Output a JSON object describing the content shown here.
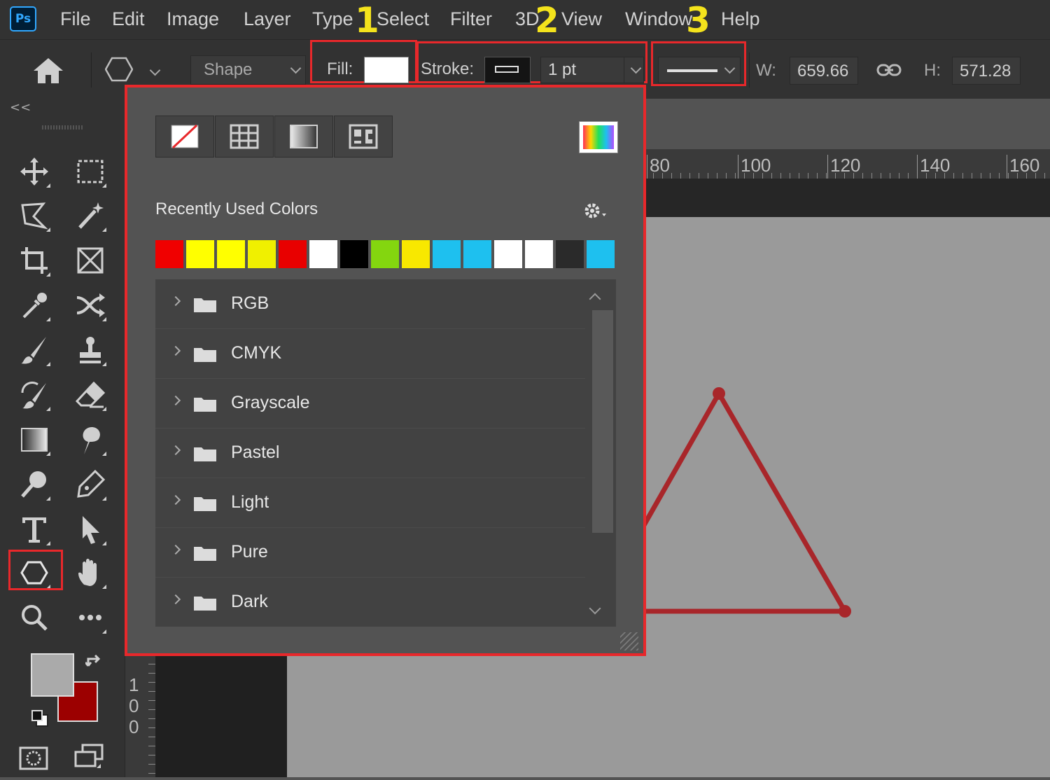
{
  "app": {
    "logo": "Ps"
  },
  "menu": [
    "File",
    "Edit",
    "Image",
    "Layer",
    "Type",
    "Select",
    "Filter",
    "3D",
    "View",
    "Window",
    "Help"
  ],
  "annotations": [
    "1",
    "2",
    "3"
  ],
  "options_bar": {
    "mode_value": "Shape",
    "fill_label": "Fill:",
    "fill_color": "#ffffff",
    "stroke_label": "Stroke:",
    "stroke_width": "1 pt",
    "w_label": "W:",
    "w_value": "659.66",
    "h_label": "H:",
    "h_value": "571.28"
  },
  "collapse_label": "<<",
  "popup": {
    "recent_label": "Recently Used Colors",
    "recent_colors": [
      "#f00000",
      "#ffff00",
      "#ffff00",
      "#f0f000",
      "#e80000",
      "#ffffff",
      "#000000",
      "#84d60f",
      "#f8e800",
      "#1ec0ef",
      "#1ec0ef",
      "#ffffff",
      "#ffffff",
      "#2a2a2a",
      "#1ec0ef"
    ],
    "folders": [
      "RGB",
      "CMYK",
      "Grayscale",
      "Pastel",
      "Light",
      "Pure",
      "Dark"
    ]
  },
  "ruler": {
    "top_ticks": [
      "80",
      "100",
      "120",
      "140",
      "160"
    ],
    "left_ticks": [
      "1",
      "0",
      "0"
    ]
  },
  "colors": {
    "foreground": "#aaaaaa",
    "background": "#9c0000",
    "highlight": "#e8282b",
    "annotation": "#f4e31c",
    "triangle_stroke": "#a8262a"
  }
}
